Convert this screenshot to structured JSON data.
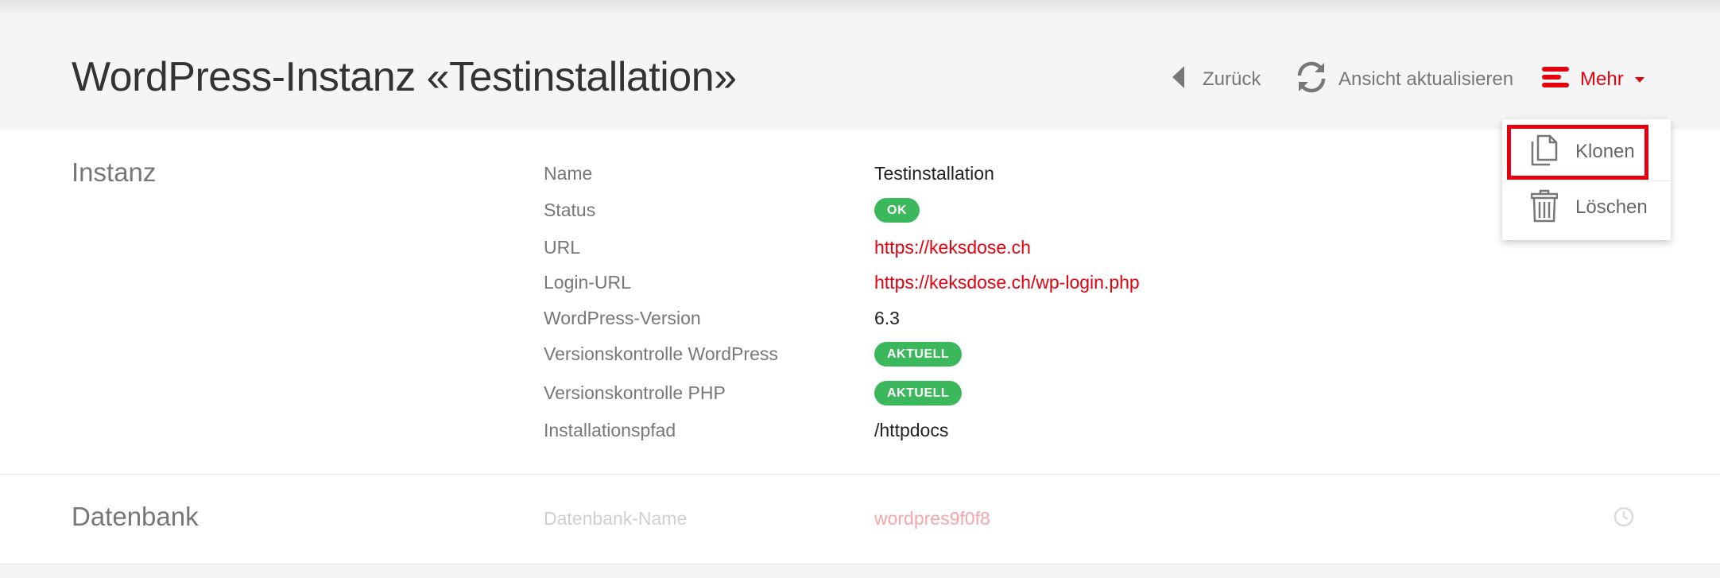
{
  "header": {
    "title": "WordPress-Instanz «Testinstallation»",
    "toolbar": {
      "back_label": "Zurück",
      "refresh_label": "Ansicht aktualisieren",
      "more_label": "Mehr"
    }
  },
  "dropdown": {
    "items": [
      {
        "label": "Klonen",
        "icon": "copy-icon"
      },
      {
        "label": "Löschen",
        "icon": "trash-icon"
      }
    ]
  },
  "instanz": {
    "title": "Instanz",
    "rows": [
      {
        "label": "Name",
        "value": "Testinstallation"
      },
      {
        "label": "Status",
        "value": "OK"
      },
      {
        "label": "URL",
        "value": "https://keksdose.ch"
      },
      {
        "label": "Login-URL",
        "value": "https://keksdose.ch/wp-login.php"
      },
      {
        "label": "WordPress-Version",
        "value": "6.3"
      },
      {
        "label": "Versionskontrolle WordPress",
        "value": "AKTUELL"
      },
      {
        "label": "Versionskontrolle PHP",
        "value": "AKTUELL"
      },
      {
        "label": "Installationspfad",
        "value": "/httpdocs"
      }
    ]
  },
  "datenbank": {
    "title": "Datenbank",
    "rows": [
      {
        "label": "Datenbank-Name",
        "value": "wordpres9f0f8"
      }
    ]
  },
  "colors": {
    "accent": "#e3000f",
    "ok_green": "#3cb85c",
    "muted_text": "#777777"
  }
}
